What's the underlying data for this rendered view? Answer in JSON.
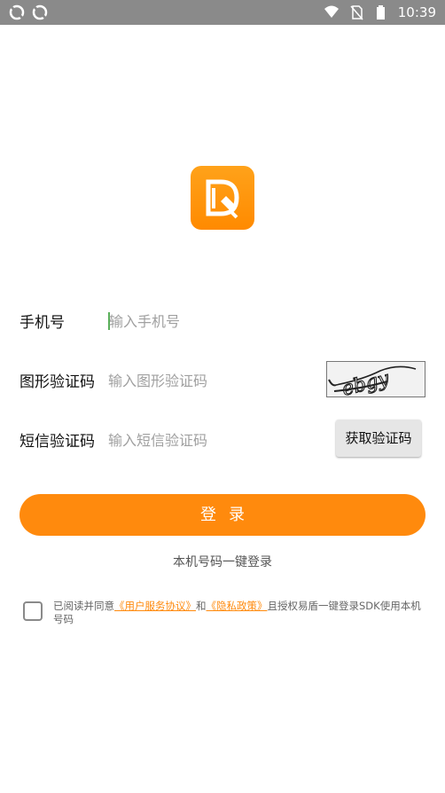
{
  "status_bar": {
    "time": "10:39",
    "icons": [
      "sync-icon",
      "sync-icon",
      "wifi-icon",
      "no-sim-icon",
      "battery-icon"
    ]
  },
  "app": {
    "logo_icon": "app-logo-icon",
    "brand_color": "#ff8a0d"
  },
  "form": {
    "phone": {
      "label": "手机号",
      "placeholder": "输入手机号"
    },
    "captcha": {
      "label": "图形验证码",
      "placeholder": "输入图形验证码"
    },
    "sms": {
      "label": "短信验证码",
      "placeholder": "输入短信验证码",
      "button": "获取验证码"
    }
  },
  "login_button": "登录",
  "one_key_login": "本机号码一键登录",
  "agreement": {
    "prefix": "已阅读并同意",
    "user_agreement": "《用户服务协议》",
    "and": "和",
    "privacy_policy": "《隐私政策》",
    "suffix": "且授权易盾一键登录SDK使用本机号码"
  }
}
